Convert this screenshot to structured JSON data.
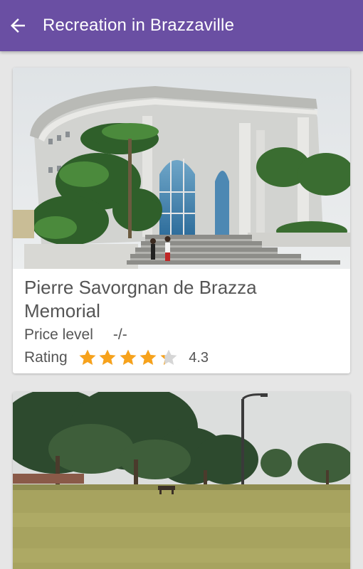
{
  "app_bar": {
    "back_icon": "arrow-left-icon",
    "title": "Recreation in Brazzaville",
    "background": "#6a4fa3"
  },
  "places": [
    {
      "name": "Pierre Savorgnan de Brazza Memorial",
      "price_label": "Price level",
      "price_value": "-/-",
      "rating_label": "Rating",
      "rating": 4.3,
      "rating_text": "4.3",
      "star_color": "#f7a21b"
    },
    {
      "name": "",
      "photo": "park-photo"
    }
  ]
}
